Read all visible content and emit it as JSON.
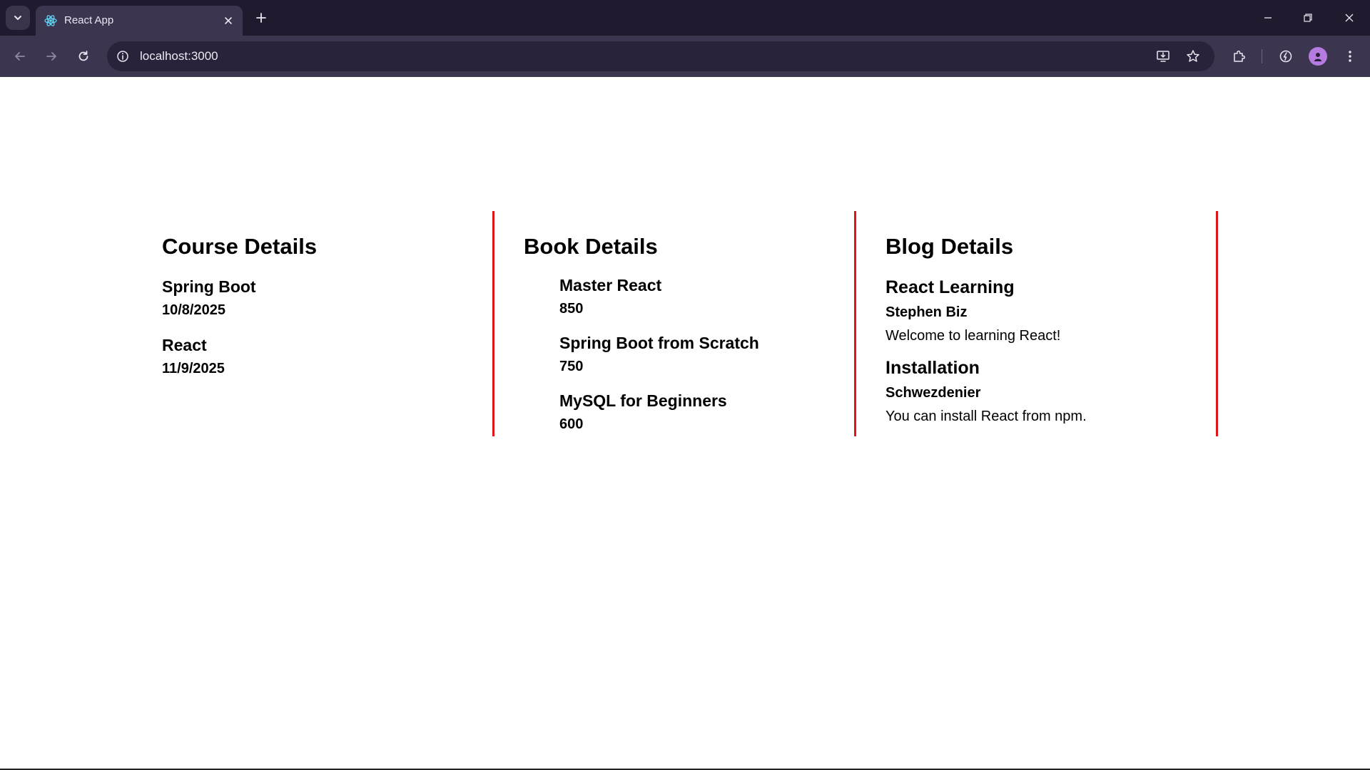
{
  "browser": {
    "tab_title": "React App",
    "url": "localhost:3000",
    "icons": {
      "tab_search": "chevron-down-icon",
      "favicon": "react-logo-icon",
      "tab_close": "close-icon",
      "new_tab": "plus-icon",
      "minimize": "minimize-icon",
      "restore": "restore-icon",
      "close_window": "close-icon",
      "back": "arrow-left-icon",
      "forward": "arrow-right-icon",
      "reload": "reload-icon",
      "site_info": "info-icon",
      "install": "install-app-icon",
      "bookmark": "star-icon",
      "extensions": "puzzle-icon",
      "performance": "performance-icon",
      "profile": "avatar-icon",
      "menu": "kebab-menu-icon"
    }
  },
  "page": {
    "course": {
      "heading": "Course Details",
      "items": [
        {
          "name": "Spring Boot",
          "date": "10/8/2025"
        },
        {
          "name": "React",
          "date": "11/9/2025"
        }
      ]
    },
    "book": {
      "heading": "Book Details",
      "items": [
        {
          "name": "Master React",
          "price": "850"
        },
        {
          "name": "Spring Boot from Scratch",
          "price": "750"
        },
        {
          "name": "MySQL for Beginners",
          "price": "600"
        }
      ]
    },
    "blog": {
      "heading": "Blog Details",
      "items": [
        {
          "title": "React Learning",
          "author": "Stephen Biz",
          "content": "Welcome to learning React!"
        },
        {
          "title": "Installation",
          "author": "Schwezdenier",
          "content": "You can install React from npm."
        }
      ]
    }
  },
  "colors": {
    "divider": "#e0151c",
    "chrome_dark": "#1f1a2e",
    "chrome_toolbar": "#3b3550",
    "omnibox": "#28223a",
    "avatar": "#b57be0"
  }
}
